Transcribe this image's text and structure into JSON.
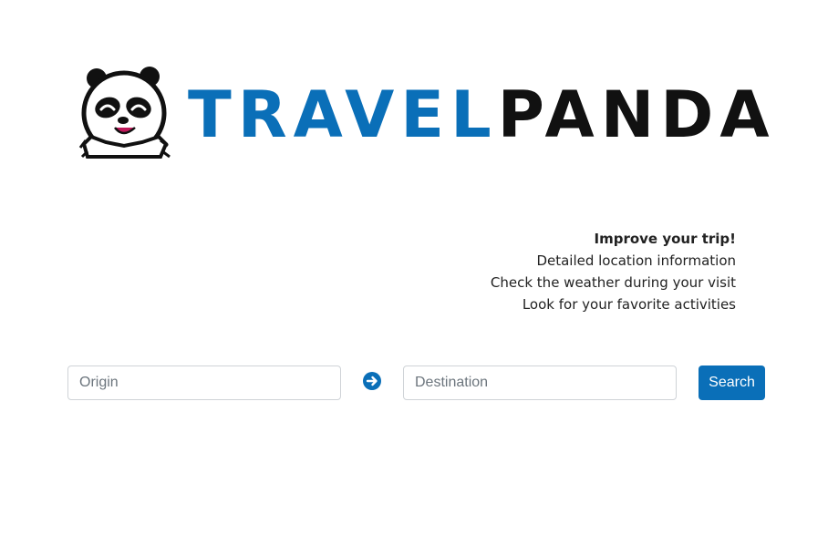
{
  "brand": {
    "word_1": "TRAVEL",
    "word_2": "PANDA",
    "color_primary": "#0a6fb8",
    "color_secondary": "#111111",
    "logo_icon": "panda-icon"
  },
  "tagline": {
    "headline": "Improve your trip!",
    "lines": [
      "Detailed location information",
      "Check the weather during your visit",
      "Look for your favorite activities"
    ]
  },
  "search": {
    "origin_placeholder": "Origin",
    "origin_value": "",
    "destination_placeholder": "Destination",
    "destination_value": "",
    "arrow_icon": "arrow-right-circle-icon",
    "button_label": "Search",
    "button_color": "#0a6fb8"
  }
}
